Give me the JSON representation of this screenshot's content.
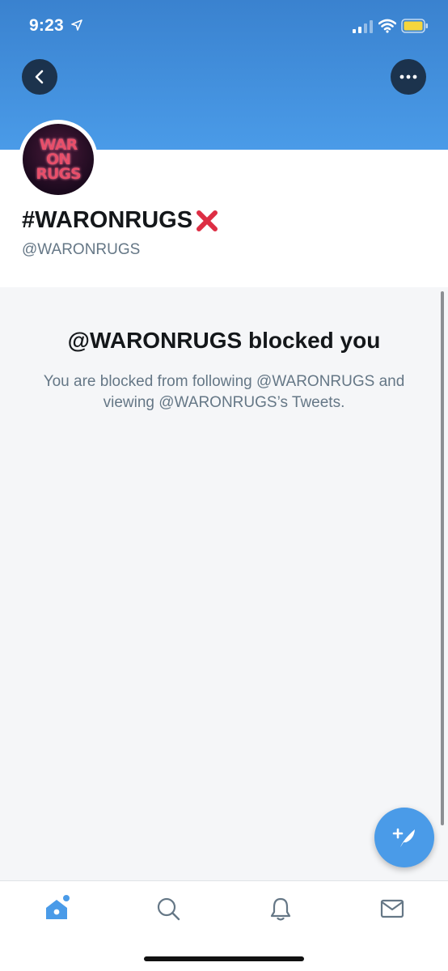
{
  "status_bar": {
    "time": "9:23",
    "icons": [
      "location-arrow-icon",
      "cellular-signal-icon",
      "wifi-icon",
      "battery-icon"
    ]
  },
  "header": {
    "back_icon": "chevron-left-icon",
    "more_icon": "more-horizontal-icon",
    "banner_color": "#4a9be8"
  },
  "profile": {
    "avatar_text_lines": [
      "WAR",
      "ON",
      "RUGS"
    ],
    "display_name": "#WARONRUGS",
    "name_emoji": "cross-mark-icon",
    "handle": "@WARONRUGS"
  },
  "blocked": {
    "title": "@WARONRUGS blocked you",
    "description": "You are blocked from following @WARONRUGS and viewing @WARONRUGS’s Tweets."
  },
  "fab": {
    "icon": "compose-tweet-icon"
  },
  "tab_bar": {
    "tabs": [
      {
        "name": "home",
        "icon": "home-icon",
        "active": true
      },
      {
        "name": "search",
        "icon": "search-icon",
        "active": false
      },
      {
        "name": "notifications",
        "icon": "bell-icon",
        "active": false
      },
      {
        "name": "messages",
        "icon": "envelope-icon",
        "active": false
      }
    ]
  },
  "colors": {
    "accent": "#4a9be8",
    "text_primary": "#14171a",
    "text_secondary": "#657786",
    "panel_bg": "#f5f6f8"
  }
}
